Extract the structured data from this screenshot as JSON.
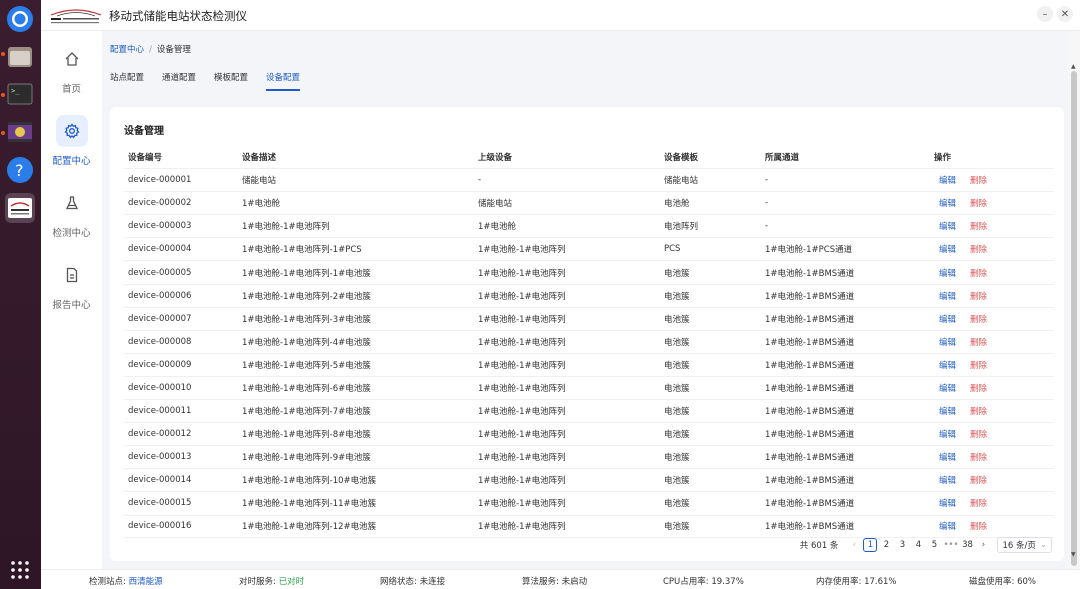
{
  "app": {
    "title": "移动式储能电站状态检测仪"
  },
  "nav": [
    {
      "label": "首页",
      "icon": "home-icon"
    },
    {
      "label": "配置中心",
      "icon": "gear-icon"
    },
    {
      "label": "检测中心",
      "icon": "flask-icon"
    },
    {
      "label": "报告中心",
      "icon": "document-icon"
    }
  ],
  "breadcrumb": {
    "parent": "配置中心",
    "separator": "/",
    "current": "设备管理"
  },
  "tabs": [
    "站点配置",
    "通道配置",
    "模板配置",
    "设备配置"
  ],
  "active_tab": 3,
  "card": {
    "title": "设备管理"
  },
  "table": {
    "headers": [
      "设备编号",
      "设备描述",
      "上级设备",
      "设备模板",
      "所属通道",
      "操作"
    ],
    "action_edit": "编辑",
    "action_delete": "删除",
    "rows": [
      [
        "device-000001",
        "储能电站",
        "-",
        "储能电站",
        "-"
      ],
      [
        "device-000002",
        "1#电池舱",
        "储能电站",
        "电池舱",
        "-"
      ],
      [
        "device-000003",
        "1#电池舱-1#电池阵列",
        "1#电池舱",
        "电池阵列",
        "-"
      ],
      [
        "device-000004",
        "1#电池舱-1#电池阵列-1#PCS",
        "1#电池舱-1#电池阵列",
        "PCS",
        "1#电池舱-1#PCS通道"
      ],
      [
        "device-000005",
        "1#电池舱-1#电池阵列-1#电池簇",
        "1#电池舱-1#电池阵列",
        "电池簇",
        "1#电池舱-1#BMS通道"
      ],
      [
        "device-000006",
        "1#电池舱-1#电池阵列-2#电池簇",
        "1#电池舱-1#电池阵列",
        "电池簇",
        "1#电池舱-1#BMS通道"
      ],
      [
        "device-000007",
        "1#电池舱-1#电池阵列-3#电池簇",
        "1#电池舱-1#电池阵列",
        "电池簇",
        "1#电池舱-1#BMS通道"
      ],
      [
        "device-000008",
        "1#电池舱-1#电池阵列-4#电池簇",
        "1#电池舱-1#电池阵列",
        "电池簇",
        "1#电池舱-1#BMS通道"
      ],
      [
        "device-000009",
        "1#电池舱-1#电池阵列-5#电池簇",
        "1#电池舱-1#电池阵列",
        "电池簇",
        "1#电池舱-1#BMS通道"
      ],
      [
        "device-000010",
        "1#电池舱-1#电池阵列-6#电池簇",
        "1#电池舱-1#电池阵列",
        "电池簇",
        "1#电池舱-1#BMS通道"
      ],
      [
        "device-000011",
        "1#电池舱-1#电池阵列-7#电池簇",
        "1#电池舱-1#电池阵列",
        "电池簇",
        "1#电池舱-1#BMS通道"
      ],
      [
        "device-000012",
        "1#电池舱-1#电池阵列-8#电池簇",
        "1#电池舱-1#电池阵列",
        "电池簇",
        "1#电池舱-1#BMS通道"
      ],
      [
        "device-000013",
        "1#电池舱-1#电池阵列-9#电池簇",
        "1#电池舱-1#电池阵列",
        "电池簇",
        "1#电池舱-1#BMS通道"
      ],
      [
        "device-000014",
        "1#电池舱-1#电池阵列-10#电池簇",
        "1#电池舱-1#电池阵列",
        "电池簇",
        "1#电池舱-1#BMS通道"
      ],
      [
        "device-000015",
        "1#电池舱-1#电池阵列-11#电池簇",
        "1#电池舱-1#电池阵列",
        "电池簇",
        "1#电池舱-1#BMS通道"
      ],
      [
        "device-000016",
        "1#电池舱-1#电池阵列-12#电池簇",
        "1#电池舱-1#电池阵列",
        "电池簇",
        "1#电池舱-1#BMS通道"
      ]
    ]
  },
  "pagination": {
    "total": "共 601 条",
    "prev": "‹",
    "pages": [
      "1",
      "2",
      "3",
      "4",
      "5"
    ],
    "ellipsis": "•••",
    "last": "38",
    "next": "›",
    "page_size": "16 条/页",
    "current": "1"
  },
  "status": {
    "station_label": "检测站点:",
    "station_value": "西清能源",
    "time_label": "对时服务:",
    "time_value": "已对时",
    "net_label": "网络状态:",
    "net_value": "未连接",
    "algo_label": "算法服务:",
    "algo_value": "未启动",
    "cpu_label": "CPU占用率:",
    "cpu_value": "19.37%",
    "mem_label": "内存使用率:",
    "mem_value": "17.61%",
    "disk_label": "磁盘使用率:",
    "disk_value": "60%"
  },
  "colors": {
    "accent": "#1f5cc9",
    "danger": "#e05555",
    "success": "#2ea44f"
  }
}
